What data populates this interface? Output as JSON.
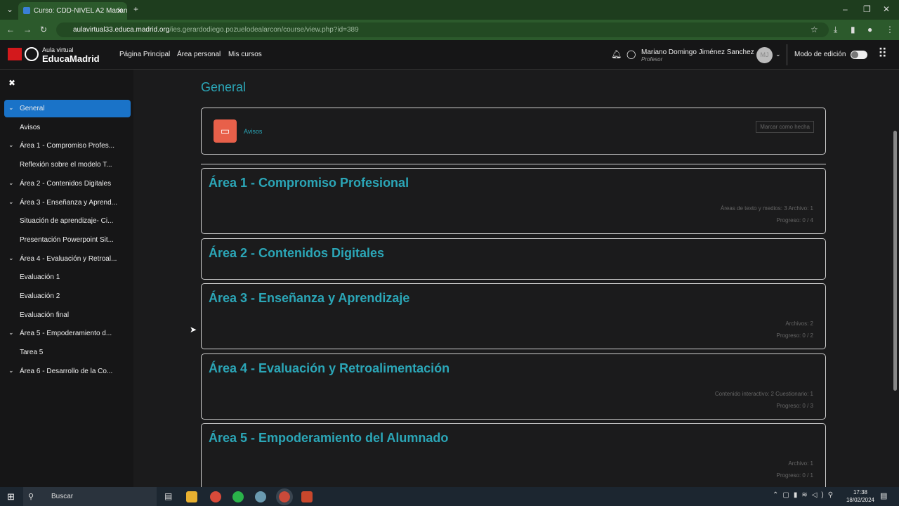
{
  "browser": {
    "tab_title": "Curso: CDD-NIVEL A2 Mariano",
    "url_host": "aulavirtual33.educa.madrid.org",
    "url_path": "/ies.gerardodiego.pozuelodealarcon/course/view.php?id=389"
  },
  "nav": {
    "logo_top": "Aula virtual",
    "logo_bottom": "EducaMadrid",
    "links": [
      "Página Principal",
      "Área personal",
      "Mis cursos"
    ],
    "user_name": "Mariano Domingo Jiménez Sanchez",
    "user_role": "Profesor",
    "avatar": "MJ",
    "edit_mode": "Modo de edición",
    "edit_mode_on": false
  },
  "sidebar": {
    "items": [
      {
        "label": "General",
        "chev": true,
        "active": true
      },
      {
        "label": "Avisos",
        "chev": false
      },
      {
        "label": "Área 1 - Compromiso Profes...",
        "chev": true
      },
      {
        "label": "Reflexión sobre el modelo T...",
        "chev": false
      },
      {
        "label": "Área 2 - Contenidos Digitales",
        "chev": true
      },
      {
        "label": "Área 3 - Enseñanza y Aprend...",
        "chev": true
      },
      {
        "label": "Situación de aprendizaje- Ci...",
        "chev": false
      },
      {
        "label": "Presentación Powerpoint Sit...",
        "chev": false
      },
      {
        "label": "Área 4 - Evaluación y Retroal...",
        "chev": true
      },
      {
        "label": "Evaluación 1",
        "chev": false
      },
      {
        "label": "Evaluación 2",
        "chev": false
      },
      {
        "label": "Evaluación final",
        "chev": false
      },
      {
        "label": "Área 5 - Empoderamiento d...",
        "chev": true
      },
      {
        "label": "Tarea 5",
        "chev": false
      },
      {
        "label": "Área 6 - Desarrollo de la Co...",
        "chev": true
      }
    ]
  },
  "main": {
    "title": "General",
    "avisos": {
      "label": "Avisos",
      "button": "Marcar como hecha"
    },
    "sections": [
      {
        "title": "Área 1 - Compromiso Profesional",
        "meta": "Áreas de texto y medios: 3   Archivo: 1",
        "progress": "Progreso: 0 / 4"
      },
      {
        "title": "Área 2 - Contenidos Digitales",
        "meta": "",
        "progress": ""
      },
      {
        "title": "Área 3 - Enseñanza y Aprendizaje",
        "meta": "Archivos: 2",
        "progress": "Progreso: 0 / 2"
      },
      {
        "title": "Área 4 - Evaluación y Retroalimentación",
        "meta": "Contenido interactivo: 2   Cuestionario: 1",
        "progress": "Progreso: 0 / 3"
      },
      {
        "title": "Área 5 - Empoderamiento del Alumnado",
        "meta": "Archivo: 1",
        "progress": "Progreso: 0 / 1"
      }
    ]
  },
  "taskbar": {
    "search": "Buscar",
    "time": "17:38",
    "date": "18/02/2024"
  }
}
